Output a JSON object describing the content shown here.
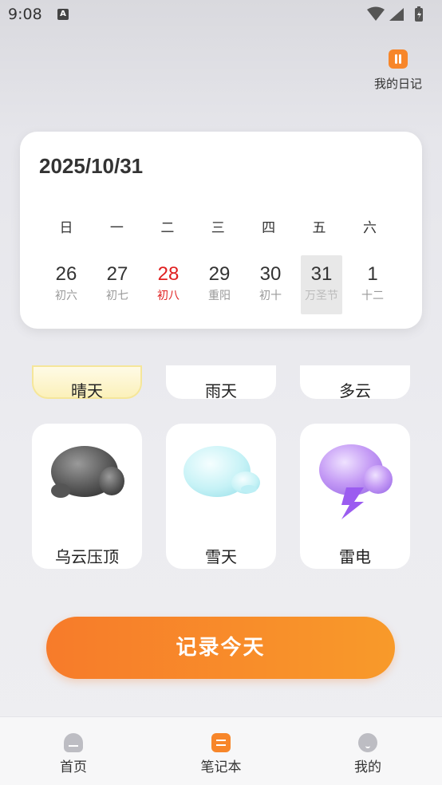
{
  "status_bar": {
    "time": "9:08",
    "notification_icon": "A"
  },
  "header": {
    "diary_label": "我的日记"
  },
  "calendar": {
    "date": "2025/10/31",
    "weekdays": [
      "日",
      "一",
      "二",
      "三",
      "四",
      "五",
      "六"
    ],
    "days": [
      {
        "num": "26",
        "sub": "初六"
      },
      {
        "num": "27",
        "sub": "初七"
      },
      {
        "num": "28",
        "sub": "初八"
      },
      {
        "num": "29",
        "sub": "重阳"
      },
      {
        "num": "30",
        "sub": "初十"
      },
      {
        "num": "31",
        "sub": "万圣节"
      },
      {
        "num": "1",
        "sub": "十二"
      }
    ],
    "today_color": "#e02020"
  },
  "weather": {
    "row1": [
      "晴天",
      "雨天",
      "多云"
    ],
    "row2": [
      "乌云压顶",
      "雪天",
      "雷电"
    ]
  },
  "record_button": {
    "label": "记录今天",
    "color": "#f77b2a"
  },
  "nav": {
    "home": "首页",
    "notebook": "笔记本",
    "mine": "我的"
  },
  "colors": {
    "accent": "#f7862a"
  }
}
